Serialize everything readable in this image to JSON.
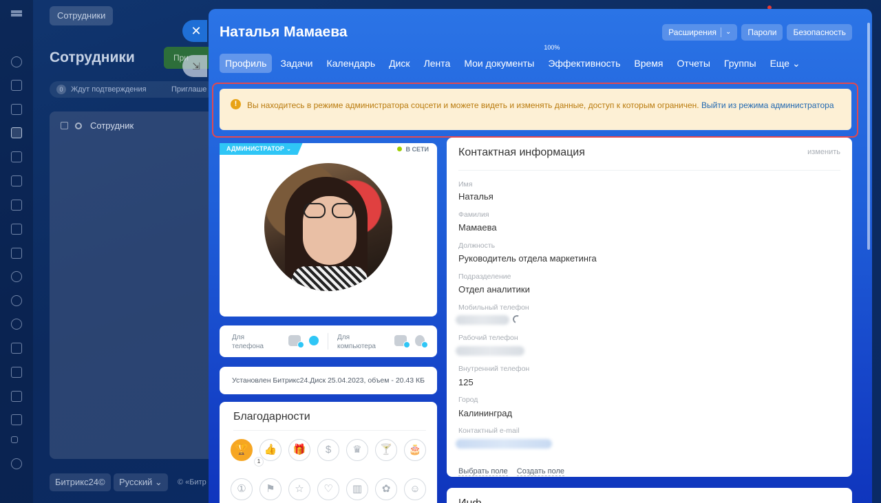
{
  "background": {
    "breadcrumb": "Сотрудники",
    "page_title": "Сотрудники",
    "add_button_label": "При",
    "filter": {
      "count": "0",
      "awaiting_label": "Ждут подтверждения",
      "invited_label": "Приглаше"
    },
    "grid_header_label": "Сотрудник",
    "footer": {
      "brand": "Битрикс24©",
      "language": "Русский ⌄",
      "copyright": "© «Битр"
    },
    "close_glyph": "✕",
    "collapse_glyph": "⇲"
  },
  "profile": {
    "user_name": "Наталья Мамаева",
    "top_buttons": {
      "extensions": "Расширения",
      "passwords": "Пароли",
      "security": "Безопасность"
    },
    "tabs": [
      {
        "label": "Профиль"
      },
      {
        "label": "Задачи"
      },
      {
        "label": "Календарь"
      },
      {
        "label": "Диск"
      },
      {
        "label": "Лента"
      },
      {
        "label": "Мои документы"
      },
      {
        "label": "Эффективность",
        "badge": "100%"
      },
      {
        "label": "Время"
      },
      {
        "label": "Отчеты"
      },
      {
        "label": "Группы"
      },
      {
        "label": "Еще ⌄"
      }
    ],
    "alert": {
      "text": "Вы находитесь в режиме администратора соцсети и можете видеть и изменять данные, доступ к которым ограничен.",
      "link": "Выйти из режима администратора"
    },
    "admin_badge": "АДМИНИСТРАТОР ⌄",
    "online_status": "В СЕТИ",
    "apps": {
      "phone_label_1": "Для",
      "phone_label_2": "телефона",
      "desktop_label_1": "Для",
      "desktop_label_2": "компьютера"
    },
    "disk_info": "Установлен Битрикс24.Диск 25.04.2023, объем - 20.43 КБ",
    "thanks": {
      "title": "Благодарности",
      "count": "1",
      "icons": [
        "trophy-icon",
        "thumbs-up-icon",
        "gift-icon",
        "money-bag-icon",
        "crown-icon",
        "cocktail-icon",
        "cake-icon",
        "medal-icon",
        "flag-icon",
        "star-icon",
        "heart-icon",
        "beer-icon",
        "flower-icon",
        "smile-icon"
      ]
    },
    "contact": {
      "title": "Контактная информация",
      "edit": "изменить",
      "fields": {
        "first_name_label": "Имя",
        "first_name": "Наталья",
        "last_name_label": "Фамилия",
        "last_name": "Мамаева",
        "position_label": "Должность",
        "position": "Руководитель отдела маркетинга",
        "department_label": "Подразделение",
        "department": "Отдел аналитики",
        "mobile_label": "Мобильный телефон",
        "work_phone_label": "Рабочий телефон",
        "internal_phone_label": "Внутренний телефон",
        "internal_phone": "125",
        "city_label": "Город",
        "city": "Калининград",
        "email_label": "Контактный e-mail"
      },
      "select_field": "Выбрать поле",
      "create_field": "Создать поле"
    },
    "next_card_title": "Инф"
  },
  "colors": {
    "accent": "#2b74e6",
    "alert_bg": "#fdf0d5",
    "alert_text": "#b97a0c",
    "alert_outline": "#e5484d",
    "admin_badge": "#2fc6f6",
    "online_dot": "#9dcf00",
    "trophy": "#f6a623"
  }
}
